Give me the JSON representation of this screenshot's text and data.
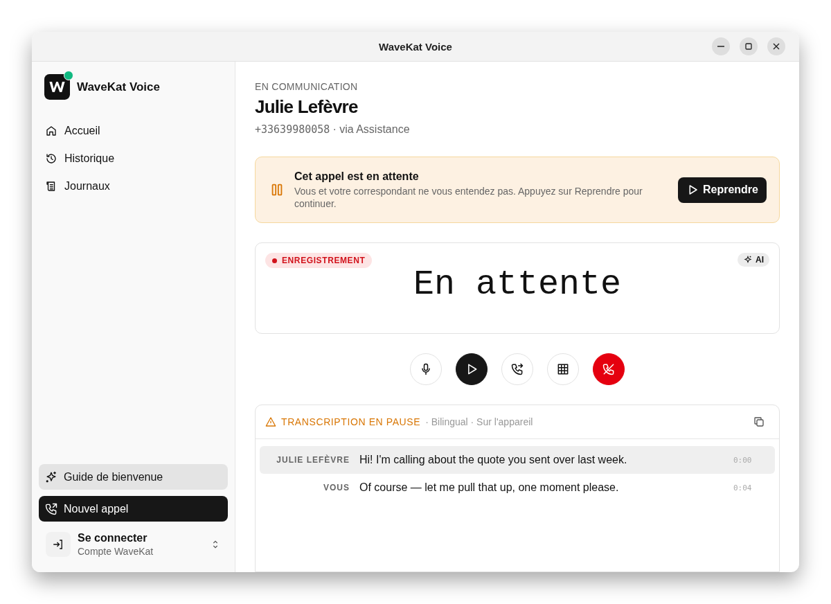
{
  "window": {
    "title": "WaveKat Voice"
  },
  "sidebar": {
    "app_name": "WaveKat Voice",
    "online": true,
    "items": [
      {
        "label": "Accueil",
        "kind": "home",
        "selected": false
      },
      {
        "label": "Historique",
        "kind": "history",
        "selected": false
      },
      {
        "label": "Journaux",
        "kind": "logs",
        "selected": false
      }
    ],
    "actions": [
      {
        "label": "Guide de bienvenue",
        "kind": "guide"
      },
      {
        "label": "Nouvel appel",
        "kind": "call"
      }
    ],
    "account": {
      "title": "Se connecter",
      "subtitle": "Compte WaveKat"
    }
  },
  "call": {
    "status": "EN COMMUNICATION",
    "name": "Julie Lefèvre",
    "number": "+33639980058",
    "via": "· via Assistance"
  },
  "hold_banner": {
    "title": "Cet appel est en attente",
    "message": "Vous et votre correspondant ne vous entendez pas. Appuyez sur Reprendre pour continuer.",
    "button": "Reprendre"
  },
  "display": {
    "badge": "ENREGISTREMENT",
    "recording": true,
    "ai_label": "AI",
    "text": "En attente"
  },
  "controls": [
    {
      "kind": "mic"
    },
    {
      "kind": "play"
    },
    {
      "kind": "transfer"
    },
    {
      "kind": "keypad"
    },
    {
      "kind": "hangup"
    }
  ],
  "transcript": {
    "status": "TRANSCRIPTION EN PAUSE",
    "details": "· Bilingual · Sur l'appareil",
    "rows": [
      {
        "speaker": "JULIE LEFÈVRE",
        "text": "Hi! I'm calling about the quote you sent over last week.",
        "time": "0:00",
        "selected": true
      },
      {
        "speaker": "VOUS",
        "text": "Of course — let me pull that up, one moment please.",
        "time": "0:04",
        "selected": false
      }
    ]
  }
}
